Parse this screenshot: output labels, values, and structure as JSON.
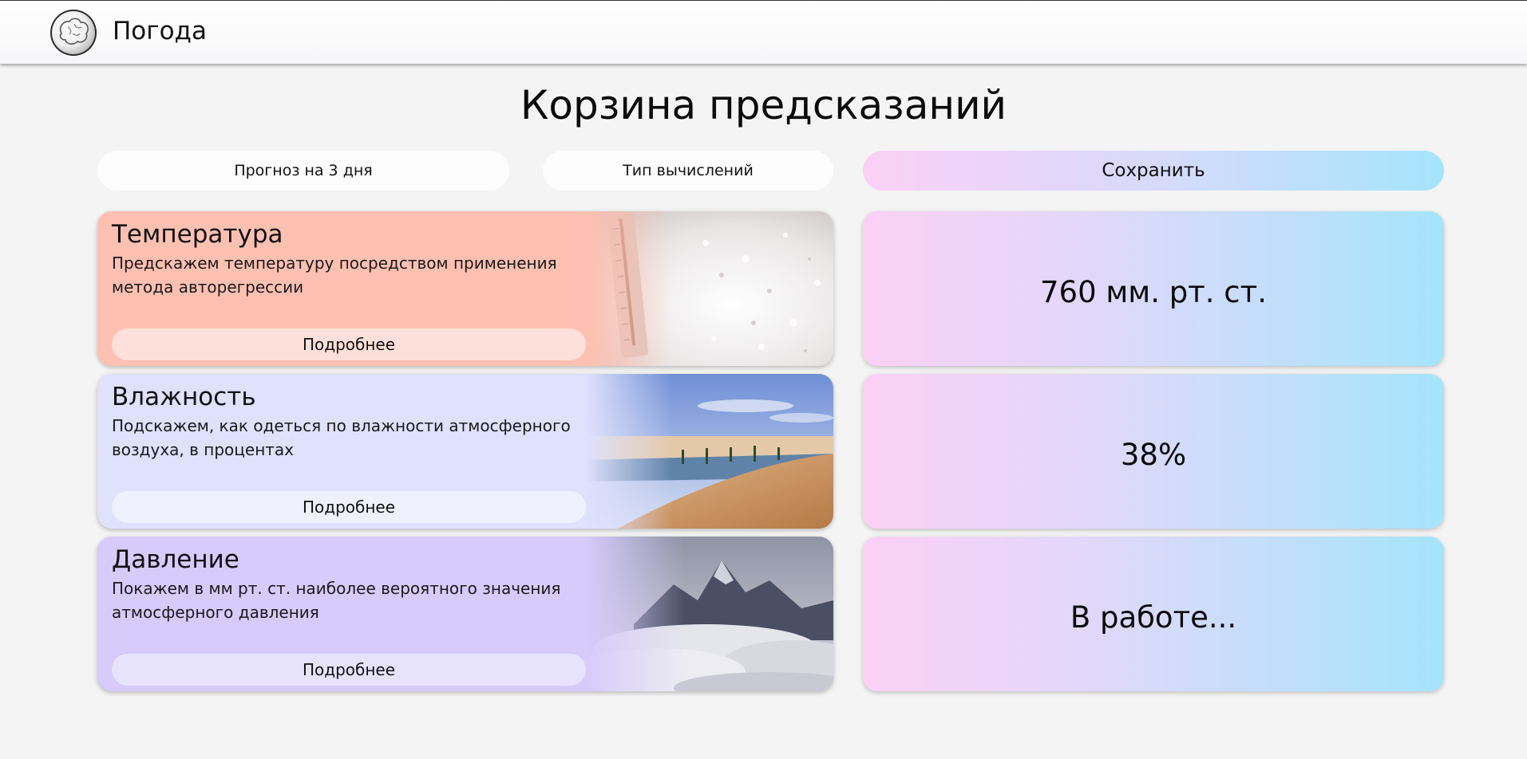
{
  "header": {
    "app_title": "Погода",
    "logo_icon": "brain-logo-icon"
  },
  "page": {
    "title": "Корзина предсказаний"
  },
  "controls": {
    "forecast_label": "Прогноз на 3 дня",
    "calc_type_label": "Тип вычислений",
    "save_label": "Сохранить"
  },
  "cards": [
    {
      "title": "Температура",
      "description": "Предскажем температуру посредством применения метода авторегрессии",
      "button_label": "Подробнее",
      "image_icon": "thermometer-snow-image",
      "color": "#fec0b1"
    },
    {
      "title": "Влажность",
      "description": "Подскажем, как одеться по влажности атмосферного воздуха, в процентах",
      "button_label": "Подробнее",
      "image_icon": "desert-oasis-image",
      "color": "#dfe1fd"
    },
    {
      "title": "Давление",
      "description": "Покажем в мм рт. ст. наиболее вероятного значения атмосферного давления",
      "button_label": "Подробнее",
      "image_icon": "mountains-clouds-image",
      "color": "#d6cbfb"
    }
  ],
  "results": [
    {
      "value": "760 мм. рт. ст."
    },
    {
      "value": "38%"
    },
    {
      "value": "В работе..."
    }
  ],
  "colors": {
    "gradient_start": "#fcd0f6",
    "gradient_end": "#a5e4fb",
    "background": "#f4f4f4"
  }
}
